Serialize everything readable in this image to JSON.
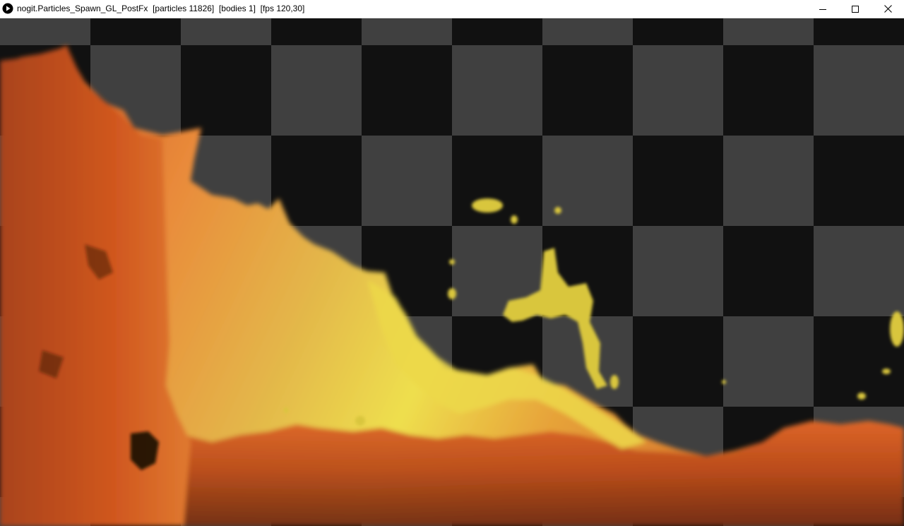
{
  "window": {
    "title": "nogit.Particles_Spawn_GL_PostFx  [particles 11826]  [bodies 1]  [fps 120,30]"
  },
  "controls": {
    "minimize_icon": "minimize-icon",
    "maximize_icon": "maximize-icon",
    "close_icon": "close-icon"
  },
  "scene": {
    "checker_dark": "#111111",
    "checker_light": "#404040",
    "fluid_colors": [
      "#7a2a0c",
      "#d2571e",
      "#f08a30",
      "#e6d84a",
      "#f2f050"
    ]
  }
}
